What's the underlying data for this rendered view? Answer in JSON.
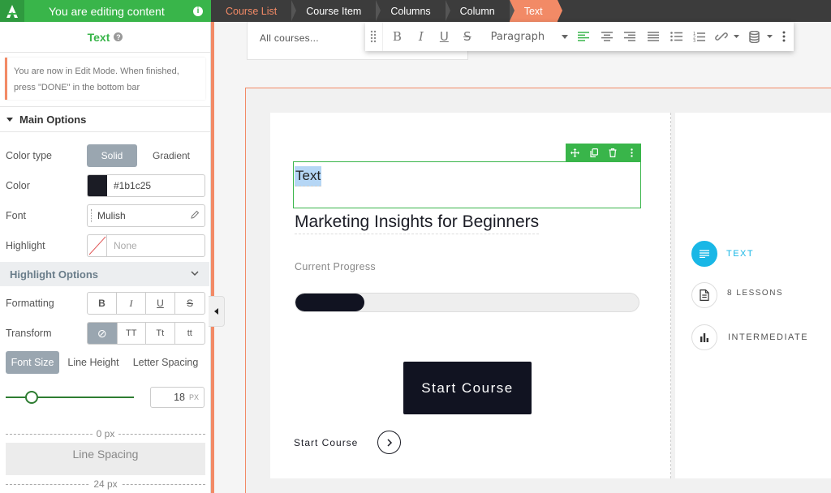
{
  "topbar": {
    "banner_text": "You are editing content",
    "info_icon": "i",
    "breadcrumbs": [
      "Course List",
      "Course Item",
      "Columns",
      "Column",
      "Text"
    ]
  },
  "sidebar": {
    "title": "Text",
    "help_icon": "?",
    "notice": "You are now in Edit Mode. When finished, press \"DONE\" in the bottom bar",
    "main_options_label": "Main Options",
    "color_type": {
      "label": "Color type",
      "options": [
        "Solid",
        "Gradient"
      ],
      "selected": "Solid"
    },
    "color": {
      "label": "Color",
      "value": "#1b1c25",
      "swatch": "#1b1c25"
    },
    "font": {
      "label": "Font",
      "value": "Mulish"
    },
    "highlight": {
      "label": "Highlight",
      "value": "None"
    },
    "highlight_options_label": "Highlight Options",
    "formatting": {
      "label": "Formatting",
      "buttons": [
        "B",
        "I",
        "U",
        "S"
      ]
    },
    "transform": {
      "label": "Transform",
      "buttons": [
        "⊘",
        "TT",
        "Tt",
        "tt"
      ]
    },
    "tabs": [
      "Font Size",
      "Line Height",
      "Letter Spacing"
    ],
    "active_tab": "Font Size",
    "font_size": {
      "value": "18",
      "unit": "PX",
      "slider_fraction": 0.2
    },
    "line_spacing": {
      "top_label": "0 px",
      "box_label": "Line Spacing",
      "bottom_label": "24 px"
    }
  },
  "canvas": {
    "courses_label": "All courses...",
    "toolbar": {
      "paragraph_label": "Paragraph"
    },
    "text_value": "Text",
    "course_title": "Marketing Insights for Beginners",
    "progress_label": "Current Progress",
    "progress_fraction": 0.2,
    "start_button_label": "Start Course",
    "start_link_label": "Start Course",
    "meta": [
      {
        "icon": "text-lines-icon",
        "label": "TEXT",
        "active": true
      },
      {
        "icon": "document-icon",
        "label": "8 LESSONS",
        "active": false
      },
      {
        "icon": "bar-chart-icon",
        "label": "INTERMEDIATE",
        "active": false
      }
    ]
  },
  "colors": {
    "accent_green": "#39b54a",
    "accent_orange": "#f28a66",
    "dark": "#111321",
    "info_blue": "#19b7e6"
  }
}
